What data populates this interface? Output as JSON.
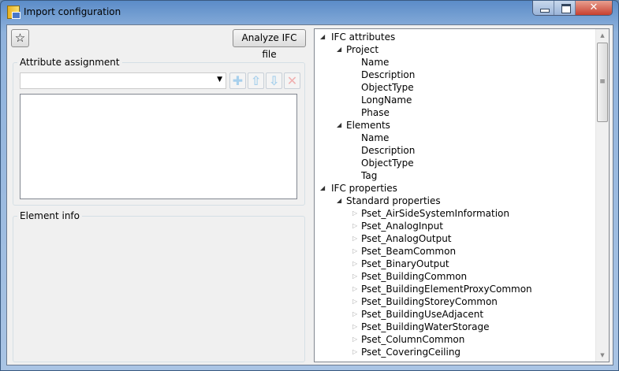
{
  "window": {
    "title": "Import configuration",
    "controls": [
      "minimize",
      "maximize",
      "close"
    ]
  },
  "toolbar": {
    "analyze_label": "Analyze IFC file",
    "favorite_icon": "star-icon"
  },
  "attribute_assignment": {
    "legend": "Attribute assignment",
    "combo_value": "",
    "buttons": [
      "add",
      "move-up",
      "move-down",
      "delete"
    ]
  },
  "element_info": {
    "legend": "Element info"
  },
  "tree": [
    {
      "label": "IFC attributes",
      "level": 0,
      "expanded": true
    },
    {
      "label": "Project",
      "level": 1,
      "expanded": true
    },
    {
      "label": "Name",
      "level": 2
    },
    {
      "label": "Description",
      "level": 2
    },
    {
      "label": "ObjectType",
      "level": 2
    },
    {
      "label": "LongName",
      "level": 2
    },
    {
      "label": "Phase",
      "level": 2
    },
    {
      "label": "Elements",
      "level": 1,
      "expanded": true
    },
    {
      "label": "Name",
      "level": 2
    },
    {
      "label": "Description",
      "level": 2
    },
    {
      "label": "ObjectType",
      "level": 2
    },
    {
      "label": "Tag",
      "level": 2
    },
    {
      "label": "IFC properties",
      "level": 0,
      "expanded": true
    },
    {
      "label": "Standard properties",
      "level": 1,
      "expanded": true
    },
    {
      "label": "Pset_AirSideSystemInformation",
      "level": 2,
      "expanded": false
    },
    {
      "label": "Pset_AnalogInput",
      "level": 2,
      "expanded": false
    },
    {
      "label": "Pset_AnalogOutput",
      "level": 2,
      "expanded": false
    },
    {
      "label": "Pset_BeamCommon",
      "level": 2,
      "expanded": false
    },
    {
      "label": "Pset_BinaryOutput",
      "level": 2,
      "expanded": false
    },
    {
      "label": "Pset_BuildingCommon",
      "level": 2,
      "expanded": false
    },
    {
      "label": "Pset_BuildingElementProxyCommon",
      "level": 2,
      "expanded": false
    },
    {
      "label": "Pset_BuildingStoreyCommon",
      "level": 2,
      "expanded": false
    },
    {
      "label": "Pset_BuildingUseAdjacent",
      "level": 2,
      "expanded": false
    },
    {
      "label": "Pset_BuildingWaterStorage",
      "level": 2,
      "expanded": false
    },
    {
      "label": "Pset_ColumnCommon",
      "level": 2,
      "expanded": false
    },
    {
      "label": "Pset_CoveringCeiling",
      "level": 2,
      "expanded": false
    }
  ]
}
